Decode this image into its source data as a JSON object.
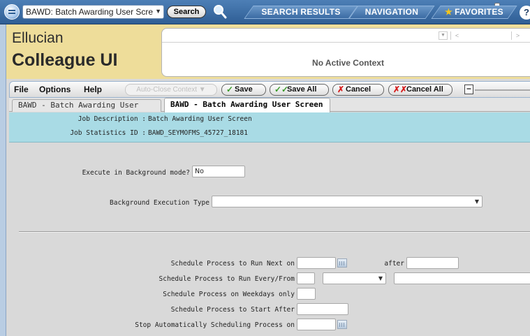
{
  "search_bar": {
    "selected_form": "BAWD: Batch Awarding User Scre",
    "search_label": "Search",
    "tabs": [
      {
        "label": "SEARCH RESULTS"
      },
      {
        "label": "NAVIGATION"
      },
      {
        "label": "FAVORITES"
      }
    ],
    "help_glyph": "?"
  },
  "brand": {
    "line1": "Ellucian",
    "line2": "Colleague UI"
  },
  "context": {
    "message": "No Active Context",
    "prev_glyph": "<",
    "next_glyph": ">"
  },
  "menu": {
    "file": "File",
    "options": "Options",
    "help": "Help"
  },
  "toolbar": {
    "auto_close": "Auto-Close Context",
    "save": "Save",
    "save_all": "Save All",
    "cancel": "Cancel",
    "cancel_all": "Cancel All",
    "zoom_minus": "−"
  },
  "form_tabs": [
    {
      "label": "BAWD - Batch Awarding User Screen"
    },
    {
      "label": "BAWD - Batch Awarding User Screen"
    }
  ],
  "info": {
    "job_description_label": "Job Description :",
    "job_description_value": "Batch Awarding User Screen",
    "job_stats_label": "Job Statistics ID :",
    "job_stats_value": "BAWD_SEYMOFMS_45727_18181"
  },
  "form": {
    "background_mode_label": "Execute in Background mode?",
    "background_mode_value": "No",
    "background_type_label": "Background Execution Type",
    "background_type_value": "",
    "run_next_label": "Schedule Process to Run Next on",
    "run_next_value": "",
    "after_label": "after",
    "after_value": "",
    "run_every_label": "Schedule Process to Run Every/From",
    "run_every_value": "",
    "run_every_unit": "",
    "run_every_from": "",
    "weekdays_label": "Schedule Process on Weekdays only",
    "weekdays_value": "",
    "start_after_label": "Schedule Process to Start After",
    "start_after_value": "",
    "stop_label": "Stop Automatically Scheduling Process on",
    "stop_value": ""
  },
  "colors": {
    "top_bar": "#2f5e95",
    "brand_background": "#eedd9a",
    "info_band": "#a9dbe5",
    "form_background": "#d9d9d9",
    "save_icon": "#3b9a2a",
    "cancel_icon": "#d51c1c"
  },
  "icons": {
    "app": "app-menu-icon",
    "search_glass": "magnifier-icon",
    "favorites": "star-icon",
    "save": "checkmark-icon",
    "save_all": "double-checkmark-icon",
    "cancel": "x-icon",
    "cancel_all": "double-x-icon",
    "calendar": "calendar-icon"
  }
}
